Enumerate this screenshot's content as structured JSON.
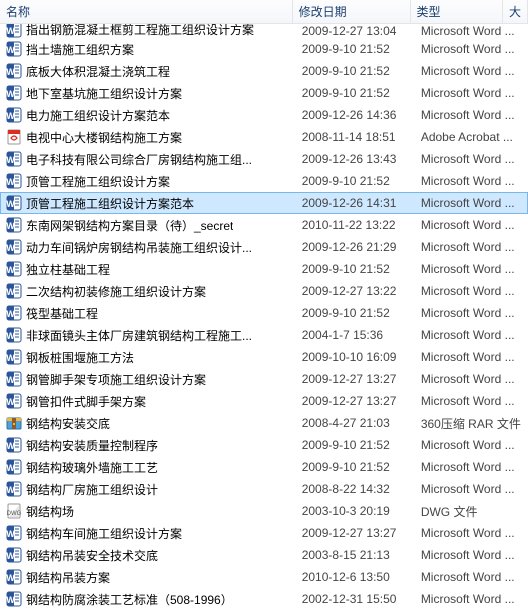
{
  "columns": {
    "name": "名称",
    "date": "修改日期",
    "type": "类型",
    "size": "大"
  },
  "icons": {
    "word": "word",
    "pdf": "pdf",
    "rar": "rar",
    "dwg": "dwg"
  },
  "rows": [
    {
      "icon": "word",
      "name": "指出钢筋混凝土框剪工程施工组织设计方案",
      "date": "2009-12-27 13:04",
      "type": "Microsoft Word ...",
      "selected": false,
      "cutoff_top": true
    },
    {
      "icon": "word",
      "name": "挡土墙施工组织方案",
      "date": "2009-9-10 21:52",
      "type": "Microsoft Word ...",
      "selected": false
    },
    {
      "icon": "word",
      "name": "底板大体积混凝土浇筑工程",
      "date": "2009-9-10 21:52",
      "type": "Microsoft Word ...",
      "selected": false
    },
    {
      "icon": "word",
      "name": "地下室基坑施工组织设计方案",
      "date": "2009-9-10 21:52",
      "type": "Microsoft Word ...",
      "selected": false
    },
    {
      "icon": "word",
      "name": "电力施工组织设计方案范本",
      "date": "2009-12-26 14:36",
      "type": "Microsoft Word ...",
      "selected": false
    },
    {
      "icon": "pdf",
      "name": "电视中心大楼钢结构施工方案",
      "date": "2008-11-14 18:51",
      "type": "Adobe Acrobat ...",
      "selected": false
    },
    {
      "icon": "word",
      "name": "电子科技有限公司综合厂房钢结构施工组...",
      "date": "2009-12-26 13:43",
      "type": "Microsoft Word ...",
      "selected": false
    },
    {
      "icon": "word",
      "name": "顶管工程施工组织设计方案",
      "date": "2009-9-10 21:52",
      "type": "Microsoft Word ...",
      "selected": false
    },
    {
      "icon": "word",
      "name": "顶管工程施工组织设计方案范本",
      "date": "2009-12-26 14:31",
      "type": "Microsoft Word ...",
      "selected": true
    },
    {
      "icon": "word",
      "name": "东南网架钢结构方案目录（待）_secret",
      "date": "2010-11-22 13:22",
      "type": "Microsoft Word ...",
      "selected": false
    },
    {
      "icon": "word",
      "name": "动力车间锅炉房钢结构吊装施工组织设计...",
      "date": "2009-12-26 21:29",
      "type": "Microsoft Word ...",
      "selected": false
    },
    {
      "icon": "word",
      "name": "独立柱基础工程",
      "date": "2009-9-10 21:52",
      "type": "Microsoft Word ...",
      "selected": false
    },
    {
      "icon": "word",
      "name": "二次结构初装修施工组织设计方案",
      "date": "2009-12-27 13:22",
      "type": "Microsoft Word ...",
      "selected": false
    },
    {
      "icon": "word",
      "name": "筏型基础工程",
      "date": "2009-9-10 21:52",
      "type": "Microsoft Word ...",
      "selected": false
    },
    {
      "icon": "word",
      "name": "非球面镜头主体厂房建筑钢结构工程施工...",
      "date": "2004-1-7 15:36",
      "type": "Microsoft Word ...",
      "selected": false
    },
    {
      "icon": "word",
      "name": "钢板桩围堰施工方法",
      "date": "2009-10-10 16:09",
      "type": "Microsoft Word ...",
      "selected": false
    },
    {
      "icon": "word",
      "name": "钢管脚手架专项施工组织设计方案",
      "date": "2009-12-27 13:27",
      "type": "Microsoft Word ...",
      "selected": false
    },
    {
      "icon": "word",
      "name": "钢管扣件式脚手架方案",
      "date": "2009-12-27 13:27",
      "type": "Microsoft Word ...",
      "selected": false
    },
    {
      "icon": "rar",
      "name": "钢结构安装交底",
      "date": "2008-4-27 21:03",
      "type": "360压缩 RAR 文件",
      "selected": false
    },
    {
      "icon": "word",
      "name": "钢结构安装质量控制程序",
      "date": "2009-9-10 21:52",
      "type": "Microsoft Word ...",
      "selected": false
    },
    {
      "icon": "word",
      "name": "钢结构玻璃外墙施工工艺",
      "date": "2009-9-10 21:52",
      "type": "Microsoft Word ...",
      "selected": false
    },
    {
      "icon": "word",
      "name": "钢结构厂房施工组织设计",
      "date": "2008-8-22 14:32",
      "type": "Microsoft Word ...",
      "selected": false
    },
    {
      "icon": "dwg",
      "name": "钢结构场",
      "date": "2003-10-3 20:19",
      "type": "DWG 文件",
      "selected": false
    },
    {
      "icon": "word",
      "name": "钢结构车间施工组织设计方案",
      "date": "2009-12-27 13:27",
      "type": "Microsoft Word ...",
      "selected": false
    },
    {
      "icon": "word",
      "name": "钢结构吊装安全技术交底",
      "date": "2003-8-15 21:13",
      "type": "Microsoft Word ...",
      "selected": false
    },
    {
      "icon": "word",
      "name": "钢结构吊装方案",
      "date": "2010-12-6 13:50",
      "type": "Microsoft Word ...",
      "selected": false
    },
    {
      "icon": "word",
      "name": "钢结构防腐涂装工艺标准（508-1996）",
      "date": "2002-12-31 15:50",
      "type": "Microsoft Word ...",
      "selected": false
    }
  ]
}
